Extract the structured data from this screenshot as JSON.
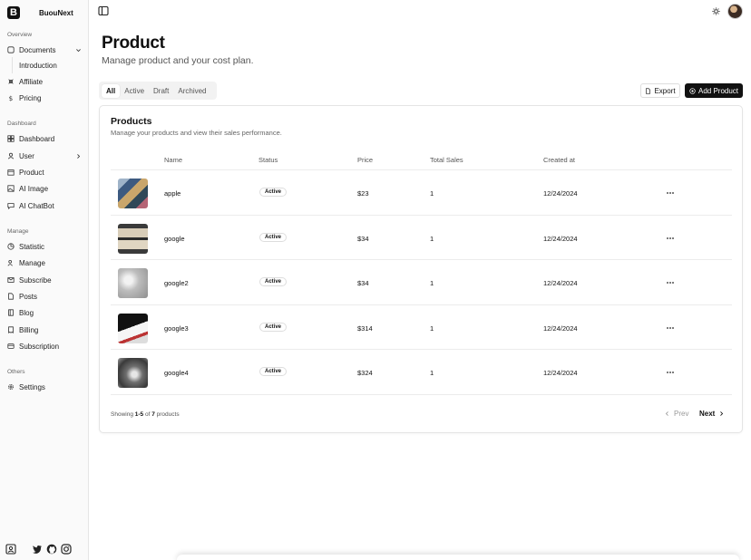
{
  "brand": {
    "logo": "B",
    "name": "BuouNext"
  },
  "nav": {
    "overview_title": "Overview",
    "documents": "Documents",
    "introduction": "Introduction",
    "affiliate": "Affiliate",
    "pricing": "Pricing",
    "dashboard_title": "Dashboard",
    "dashboard": "Dashboard",
    "user": "User",
    "product": "Product",
    "ai_image": "AI Image",
    "ai_chatbot": "AI ChatBot",
    "manage_title": "Manage",
    "statistic": "Statistic",
    "manage": "Manage",
    "subscribe": "Subscribe",
    "posts": "Posts",
    "blog": "Blog",
    "billing": "Billing",
    "subscription": "Subscription",
    "others_title": "Others",
    "settings": "Settings"
  },
  "page": {
    "title": "Product",
    "subtitle": "Manage product and your cost plan."
  },
  "tabs": [
    "All",
    "Active",
    "Draft",
    "Archived"
  ],
  "actions": {
    "export": "Export",
    "add": "Add Product"
  },
  "card": {
    "title": "Products",
    "subtitle": "Manage your products and view their sales performance."
  },
  "table": {
    "headers": {
      "name": "Name",
      "status": "Status",
      "price": "Price",
      "sales": "Total Sales",
      "created": "Created at"
    },
    "rows": [
      {
        "name": "apple",
        "status": "Active",
        "price": "$23",
        "sales": "1",
        "created": "12/24/2024"
      },
      {
        "name": "google",
        "status": "Active",
        "price": "$34",
        "sales": "1",
        "created": "12/24/2024"
      },
      {
        "name": "google2",
        "status": "Active",
        "price": "$34",
        "sales": "1",
        "created": "12/24/2024"
      },
      {
        "name": "google3",
        "status": "Active",
        "price": "$314",
        "sales": "1",
        "created": "12/24/2024"
      },
      {
        "name": "google4",
        "status": "Active",
        "price": "$324",
        "sales": "1",
        "created": "12/24/2024"
      }
    ]
  },
  "pagination": {
    "prefix": "Showing",
    "range": "1-5",
    "of": "of",
    "total": "7",
    "suffix": "products",
    "prev": "Prev",
    "next": "Next"
  },
  "colors": {
    "primary": "#111111",
    "border": "#e4e4e4",
    "muted": "#666666"
  }
}
